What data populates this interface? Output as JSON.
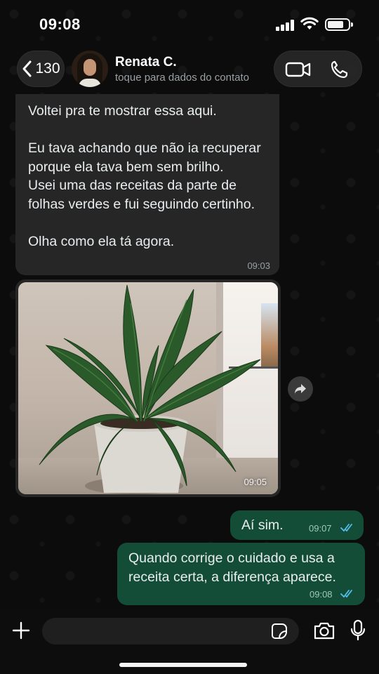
{
  "status_bar": {
    "time": "09:08"
  },
  "header": {
    "back_count": "130",
    "contact_name": "Renata C.",
    "contact_subtitle": "toque para dados do contato"
  },
  "messages": {
    "incoming_text": {
      "text": "Voltei pra te mostrar essa aqui.\n\nEu tava achando que não ia recuperar porque ela tava bem sem brilho.\nUsei uma das receitas da parte de folhas verdes e fui seguindo certinho.\n\nOlha como ela tá agora.",
      "time": "09:03"
    },
    "incoming_photo": {
      "time": "09:05"
    },
    "outgoing_1": {
      "text": "Aí sim.",
      "time": "09:07"
    },
    "outgoing_2": {
      "text": "Quando corrige o cuidado e usa a receita certa, a diferença aparece.",
      "time": "09:08"
    }
  },
  "input_bar": {
    "placeholder": ""
  },
  "icons": {
    "back": "chevron-left-icon",
    "video_call": "video-camera-icon",
    "voice_call": "phone-icon",
    "forward": "forward-arrow-icon",
    "attach": "plus-icon",
    "sticker": "sticker-icon",
    "camera": "camera-icon",
    "mic": "microphone-icon",
    "read_receipt": "double-check-icon"
  },
  "colors": {
    "incoming_bubble": "#262626",
    "outgoing_bubble": "#144d37",
    "read_ticks": "#53bdeb"
  }
}
